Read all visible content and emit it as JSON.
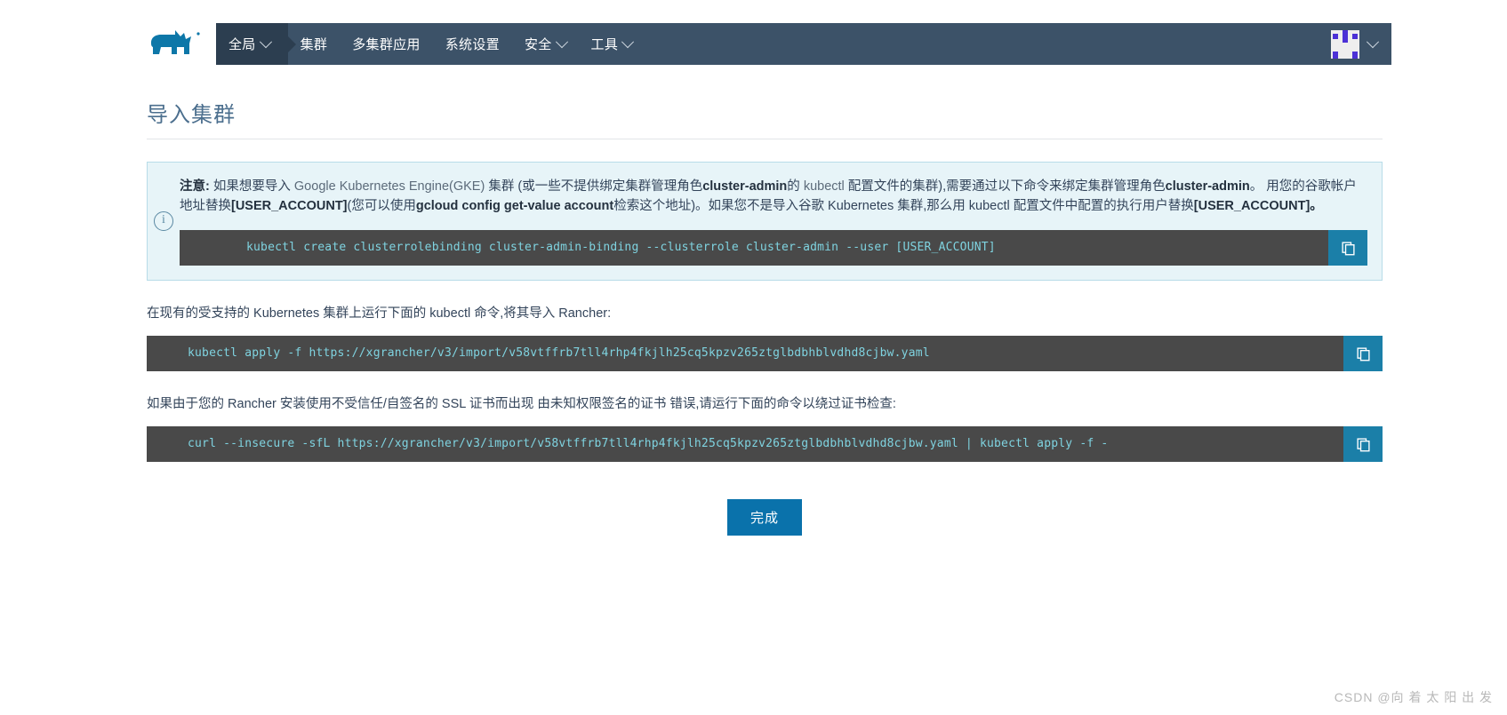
{
  "header": {
    "logo_alt": "rancher-logo",
    "nav": [
      {
        "label": "全局",
        "has_dropdown": true,
        "active": true
      },
      {
        "label": "集群",
        "has_dropdown": false,
        "active": false
      },
      {
        "label": "多集群应用",
        "has_dropdown": false,
        "active": false
      },
      {
        "label": "系统设置",
        "has_dropdown": false,
        "active": false
      },
      {
        "label": "安全",
        "has_dropdown": true,
        "active": false
      },
      {
        "label": "工具",
        "has_dropdown": true,
        "active": false
      }
    ],
    "avatar_alt": "user-avatar"
  },
  "page": {
    "title": "导入集群"
  },
  "notice": {
    "icon": "info-icon",
    "prefix_bold": "注意:",
    "line1_a": " 如果想要导入 ",
    "line1_dim1": "Google Kubernetes Engine(GKE)",
    "line1_b": " 集群 (或一些不提供绑定集群管理角色",
    "line1_bold1": "cluster-admin",
    "line1_c": "的 ",
    "line1_dim2": "kubectl",
    "line1_d": " 配置文件的集群),需要通过以下命令来绑定集群管理角色",
    "line1_bold2": "cluster-admin",
    "line1_e": "。 用您的谷歌帐户地址替换",
    "line2_bold1": "[USER_ACCOUNT]",
    "line2_a": "(您可以使用",
    "line2_bold2": "gcloud config get-value account",
    "line2_b": "检索这个地址)。如果您不是导入谷歌 Kubernetes 集群,那么用 kubectl 配置文件中配置的执行用户替换",
    "line2_bold3": "[USER_ACCOUNT]。",
    "command": "kubectl create clusterrolebinding cluster-admin-binding --clusterrole cluster-admin --user [USER_ACCOUNT]",
    "copy_label": "copy-icon"
  },
  "section_import": {
    "description": "在现有的受支持的 Kubernetes 集群上运行下面的 kubectl 命令,将其导入 Rancher:",
    "command": "kubectl apply -f https://xgrancher/v3/import/v58vtffrb7tll4rhp4fkjlh25cq5kpzv265ztglbdbhblvdhd8cjbw.yaml",
    "copy_label": "copy-icon"
  },
  "section_insecure": {
    "description": "如果由于您的 Rancher 安装使用不受信任/自签名的 SSL 证书而出现 由未知权限签名的证书 错误,请运行下面的命令以绕过证书检查:",
    "command": "curl --insecure -sfL https://xgrancher/v3/import/v58vtffrb7tll4rhp4fkjlh25cq5kpzv265ztglbdbhblvdhd8cjbw.yaml | kubectl apply -f -",
    "copy_label": "copy-icon"
  },
  "footer": {
    "done_label": "完成"
  },
  "watermark": {
    "text": "CSDN @向 着 太 阳 出 发"
  },
  "colors": {
    "header_bg": "#3c5268",
    "header_active": "#2c3e50",
    "notice_bg": "#e7f4f8",
    "notice_border": "#b8dce8",
    "code_bg": "#494949",
    "code_text": "#7fd3e0",
    "copy_btn": "#1b7fa8",
    "primary_btn": "#0a72ab",
    "title": "#4c6f8e"
  }
}
